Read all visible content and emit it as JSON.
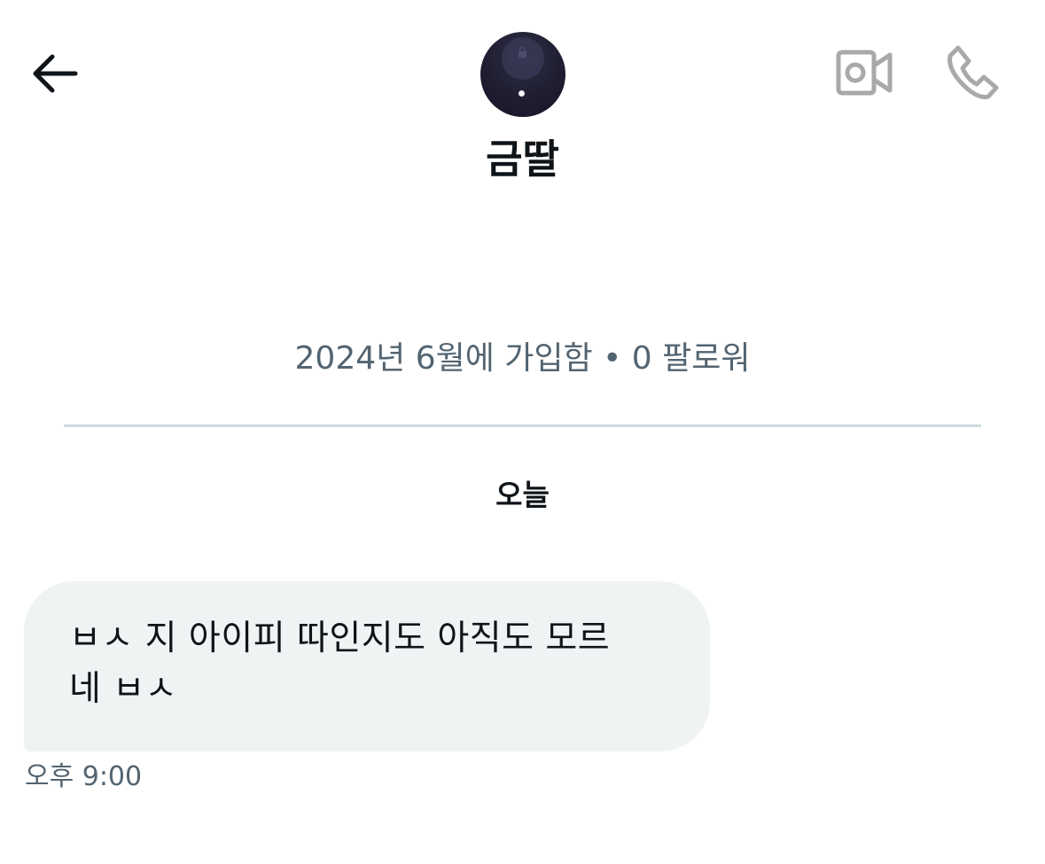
{
  "header": {
    "back_icon": "arrow-left-icon",
    "video_icon": "video-camera-icon",
    "call_icon": "phone-icon"
  },
  "profile": {
    "avatar_icon": "avatar-image",
    "name": "금딸",
    "joined": "2024년 6월에 가입함",
    "separator": "•",
    "followers": "0 팔로워",
    "joined_and_followers": "2024년 6월에 가입함 • 0 팔로워"
  },
  "conversation": {
    "date_label": "오늘",
    "messages": [
      {
        "text": "ㅂㅅ 지 아이피 따인지도 아직도 모르\n네 ㅂㅅ",
        "time": "오후 9:00",
        "bubble_color": "#eff3f4"
      }
    ]
  },
  "colors": {
    "text_primary": "#0f1419",
    "text_secondary": "#536471",
    "icon_gray": "#a9a9a9",
    "divider": "#cfd9de"
  }
}
